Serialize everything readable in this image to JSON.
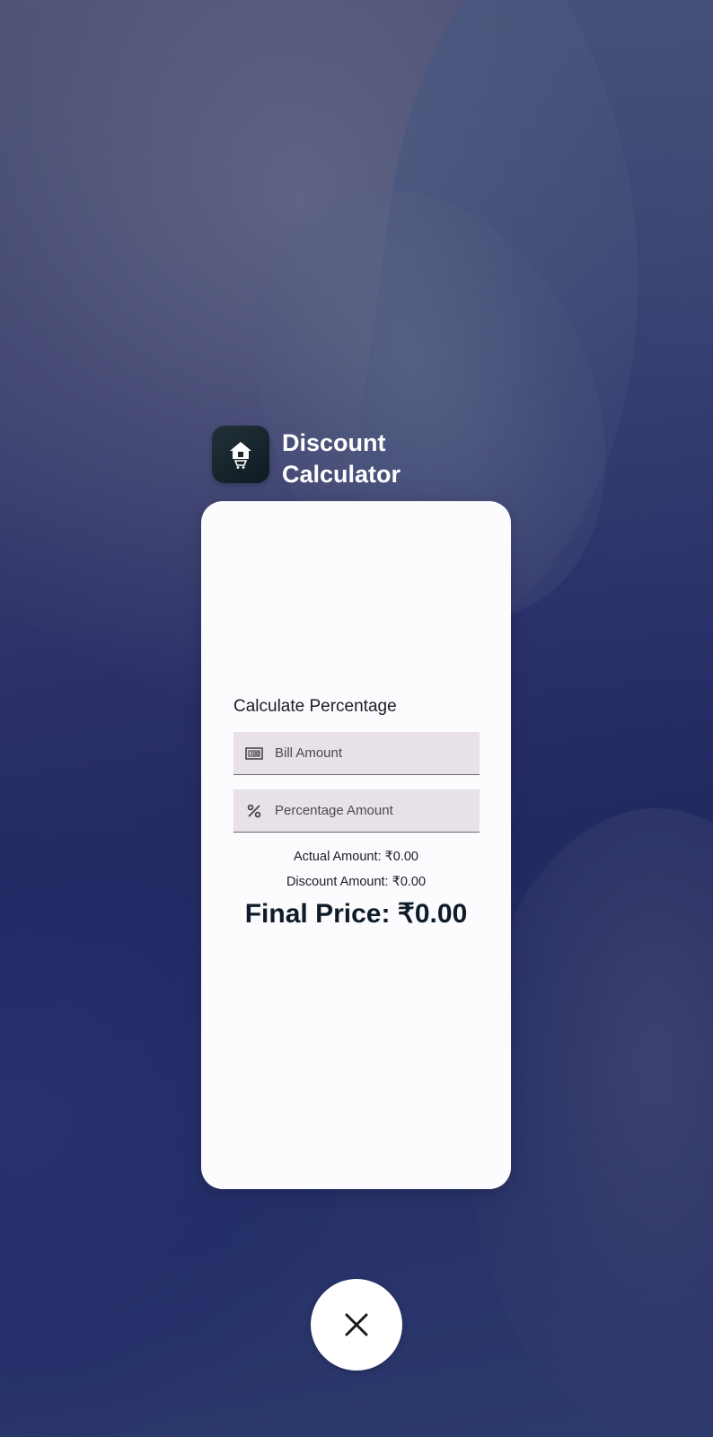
{
  "app": {
    "title": "Discount\nCalculator",
    "icon": "house-cart-icon"
  },
  "card": {
    "section_title": "Calculate Percentage",
    "bill_field": {
      "placeholder": "Bill Amount",
      "value": "",
      "icon": "cash-icon"
    },
    "percentage_field": {
      "placeholder": "Percentage Amount",
      "value": "",
      "icon": "percent-icon"
    },
    "actual_amount": "Actual Amount: ₹0.00",
    "discount_amount": "Discount Amount: ₹0.00",
    "final_price": "Final Price: ₹0.00"
  },
  "close_button": {
    "icon": "close-icon"
  },
  "colors": {
    "card_bg": "#fcfcff",
    "field_bg": "#e8e1e8",
    "app_icon_bg": "#16232a"
  }
}
